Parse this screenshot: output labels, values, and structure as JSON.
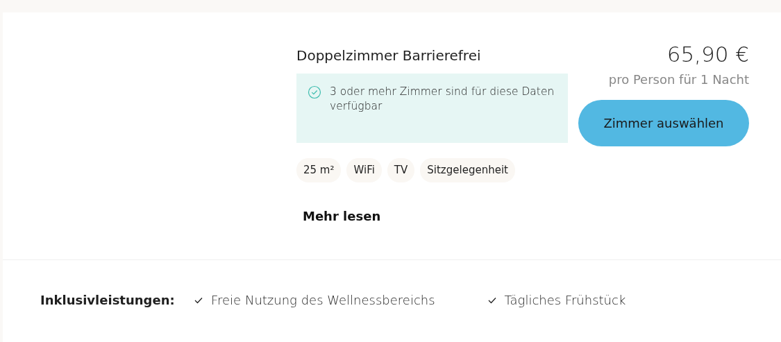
{
  "room": {
    "title": "Doppelzimmer Barrierefrei",
    "availability": "3 oder mehr Zimmer sind für diese Daten verfügbar",
    "features": [
      "25 m²",
      "WiFi",
      "TV",
      "Sitzgelegenheit"
    ],
    "more_link": "Mehr lesen",
    "price": "65,90 €",
    "price_note": "pro Person für 1 Nacht",
    "select_button": "Zimmer auswählen"
  },
  "inclusive": {
    "label": "Inklusivleistungen:",
    "items": [
      "Freie Nutzung des Wellnessbereichs",
      "Tägliches Frühstück"
    ]
  }
}
